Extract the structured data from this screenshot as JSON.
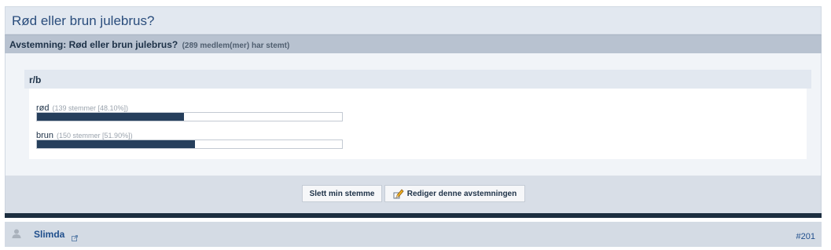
{
  "thread": {
    "title": "Rød eller brun julebrus?"
  },
  "poll": {
    "question": "Avstemning: Rød eller brun julebrus?",
    "vote_count": "(289 medlem(mer) har stemt)",
    "group_label": "r/b",
    "options": [
      {
        "label": "rød",
        "stats": "(139 stemmer [48.10%])",
        "percent": 48.1
      },
      {
        "label": "brun",
        "stats": "(150 stemmer [51.90%])",
        "percent": 51.9
      }
    ],
    "bar_color": "#263f5c"
  },
  "actions": {
    "delete_vote": "Slett min stemme",
    "edit_poll": "Rediger denne avstemningen"
  },
  "post": {
    "username": "Slimda",
    "number": "#201"
  },
  "colors": {
    "accent": "#1f4e8c",
    "dark_bar": "#1c2e40"
  }
}
